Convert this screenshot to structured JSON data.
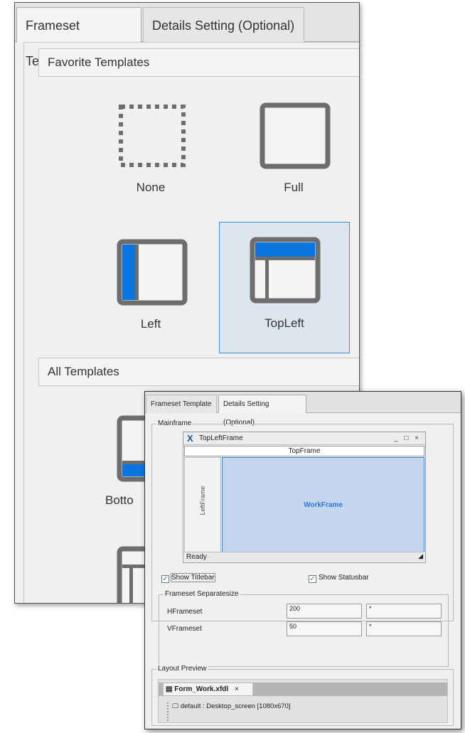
{
  "back_window": {
    "tabs": [
      {
        "label": "Frameset Template",
        "active": true
      },
      {
        "label": "Details Setting (Optional)",
        "active": false
      }
    ],
    "favorite_section": "Favorite Templates",
    "favorites": [
      {
        "label": "None",
        "icon": "dashed-frame-icon"
      },
      {
        "label": "Full",
        "icon": "full-frame-icon"
      },
      {
        "label": "Left",
        "icon": "left-frame-icon"
      },
      {
        "label": "TopLeft",
        "icon": "topleft-frame-icon",
        "selected": true
      }
    ],
    "all_section": "All Templates",
    "all": [
      {
        "label": "Botto",
        "icon": "bottom-frame-icon"
      }
    ]
  },
  "front_window": {
    "tabs": [
      {
        "label": "Frameset Template",
        "active": false
      },
      {
        "label": "Details Setting (Optional)",
        "active": true
      }
    ],
    "mainframe_group": "Mainframe",
    "preview": {
      "title": "TopLeftFrame",
      "window_controls": "_ □ ×",
      "top_frame": "TopFrame",
      "left_frame": "LeftFrame",
      "work_frame": "WorkFrame",
      "status_text": "Ready",
      "grip": "◢"
    },
    "show_titlebar": {
      "label": "Show Titlebar",
      "checked": true
    },
    "show_statusbar": {
      "label": "Show Statusbar",
      "checked": true
    },
    "separate_group": "Frameset Separatesize",
    "hframeset": {
      "label": "HFrameset",
      "value1": "200",
      "value2": "*"
    },
    "vframeset": {
      "label": "VFrameset",
      "value1": "50",
      "value2": "*"
    },
    "layout_group": "Layout Preview",
    "layout_tab": {
      "label": "Form_Work.xfdl",
      "close": "×",
      "icon": "form-icon"
    },
    "layout_item": "default : Desktop_screen [1080x670]",
    "check_mark": "✓"
  },
  "colors": {
    "accent_blue": "#0a74e0",
    "frame_gray": "#6d6d6d",
    "selection_bg": "#dde6ef"
  }
}
